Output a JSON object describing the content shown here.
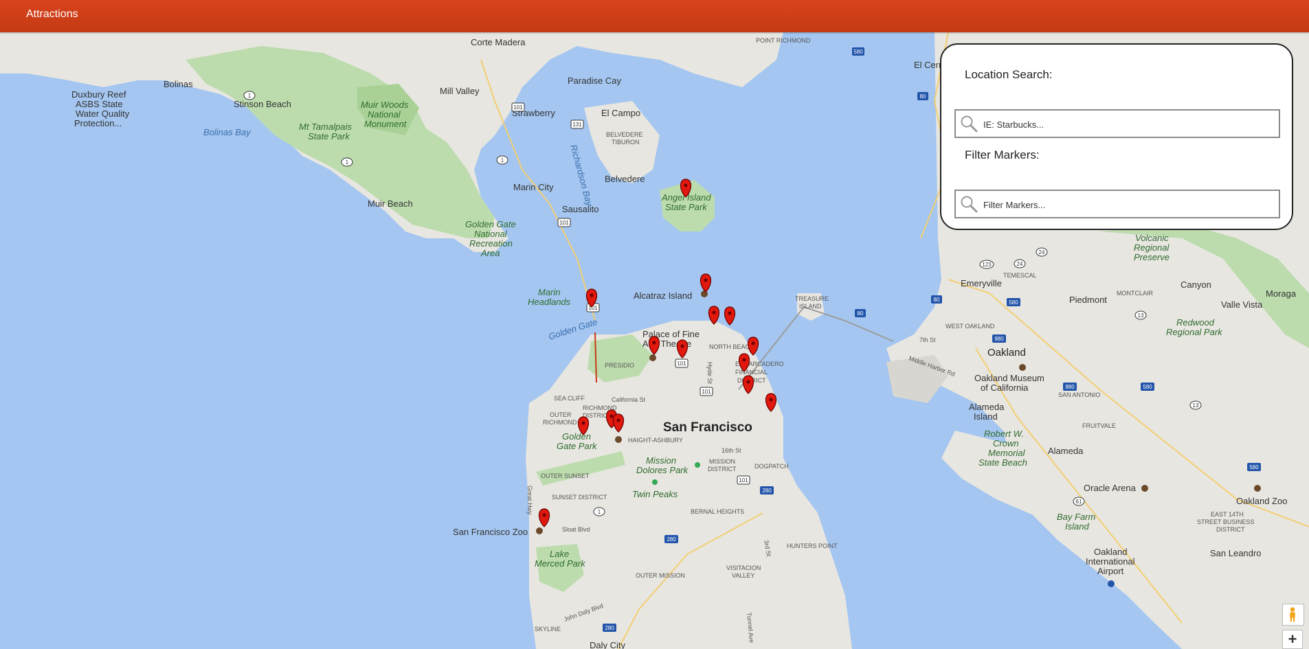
{
  "header": {
    "title": "Attractions"
  },
  "panel": {
    "location_label": "Location Search:",
    "location_placeholder": "IE: Starbucks...",
    "filter_label": "Filter Markers:",
    "filter_placeholder": "Filter Markers..."
  },
  "controls": {
    "zoom_in": "+"
  },
  "colors": {
    "header": "#d0401a",
    "water": "#a4c6f0",
    "land": "#e8e6e1",
    "park": "#bddcae",
    "marker": "#e0180d"
  },
  "labels": {
    "corte_madera": "Corte Madera",
    "point_richmond": "POINT RICHMOND",
    "el_cerrito": "El Cerri",
    "bolinas": "Bolinas",
    "duxbury": "Duxbury Reef",
    "asbs": "ASBS State",
    "water_quality": "Water Quality",
    "protection": "Protection...",
    "stinson": "Stinson Beach",
    "bolinas_bay": "Bolinas Bay",
    "mill_valley": "Mill Valley",
    "paradise_cay": "Paradise Cay",
    "muir_woods_1": "Muir Woods",
    "muir_woods_2": "National",
    "muir_woods_3": "Monument",
    "mt_tam_1": "Mt Tamalpais",
    "mt_tam_2": "State Park",
    "strawberry": "Strawberry",
    "el_campo": "El Campo",
    "belvedere_tiburon_1": "BELVEDERE",
    "belvedere_tiburon_2": "TIBURON",
    "belvedere": "Belvedere",
    "richardson_bay": "Richardson Bay",
    "marin_city": "Marin City",
    "muir_beach": "Muir Beach",
    "sausalito": "Sausalito",
    "angel_1": "Angel Island",
    "angel_2": "State Park",
    "ggnra_1": "Golden Gate",
    "ggnra_2": "National",
    "ggnra_3": "Recreation",
    "ggnra_4": "Area",
    "marin_headlands_1": "Marin",
    "marin_headlands_2": "Headlands",
    "alcatraz": "Alcatraz Island",
    "golden_gate": "Golden Gate",
    "palace_1": "Palace of Fine",
    "palace_2": "Arts Theatre",
    "presidio": "PRESIDIO",
    "north_beach": "NORTH BEACH",
    "embarcadero": "EMBARCADERO",
    "financial_1": "FINANCIAL",
    "financial_2": "DISTRICT",
    "treasure_1": "TREASURE",
    "treasure_2": "ISLAND",
    "sea_cliff": "SEA CLIFF",
    "california_st": "California St",
    "outer_richmond_1": "OUTER",
    "outer_richmond_2": "RICHMOND",
    "richmond_1": "RICHMOND",
    "richmond_2": "DISTRICT",
    "haight": "HAIGHT-ASHBURY",
    "san_francisco": "San Francisco",
    "ggpark_1": "Golden",
    "ggpark_2": "Gate Park",
    "outer_sunset": "OUTER SUNSET",
    "mission_dolores_1": "Mission",
    "mission_dolores_2": "Dolores Park",
    "mission_district_1": "MISSION",
    "mission_district_2": "DISTRICT",
    "dogpatch": "DOGPATCH",
    "sixteenth": "16th St",
    "twin_peaks": "Twin Peaks",
    "sunset_district": "SUNSET DISTRICT",
    "bernal": "BERNAL HEIGHTS",
    "sf_zoo": "San Francisco Zoo",
    "sloat": "Sloat Blvd",
    "great_hwy": "Great Hwy",
    "lake_merced_1": "Lake",
    "lake_merced_2": "Merced Park",
    "hunters_point": "HUNTERS POINT",
    "outer_mission": "OUTER MISSION",
    "visitacion_1": "VISITACION",
    "visitacion_2": "VALLEY",
    "john_daly": "John Daly Blvd",
    "daly_city": "Daly City",
    "skyline": "SKYLINE",
    "emeryville": "Emeryville",
    "temescal": "TEMESCAL",
    "piedmont": "Piedmont",
    "montclair": "MONTCLAIR",
    "canyon": "Canyon",
    "moraga": "Moraga",
    "volcanic_1": "Volcanic",
    "volcanic_2": "Regional",
    "volcanic_3": "Preserve",
    "west_oakland": "WEST OAKLAND",
    "oakland": "Oakland",
    "museum_1": "Oakland Museum",
    "museum_2": "of California",
    "seventh": "7th St",
    "middle_harbor": "Middle Harbor Rd",
    "valle_vista": "Valle Vista",
    "redwood_1": "Redwood",
    "redwood_2": "Regional Park",
    "alameda_island_1": "Alameda",
    "alameda_island_2": "Island",
    "san_antonio": "SAN ANTONIO",
    "fruitvale": "FRUITVALE",
    "crown_1": "Robert W.",
    "crown_2": "Crown",
    "crown_3": "Memorial",
    "crown_4": "State Beach",
    "alameda": "Alameda",
    "oracle_arena": "Oracle Arena",
    "oakland_zoo": "Oakland Zoo",
    "east_14th_1": "EAST 14TH",
    "east_14th_2": "STREET BUSINESS",
    "east_14th_3": "DISTRICT",
    "bay_farm_1": "Bay Farm",
    "bay_farm_2": "Island",
    "airport_1": "Oakland",
    "airport_2": "International",
    "airport_3": "Airport",
    "san_leandro": "San Leandro",
    "hyde_st": "Hyde St",
    "third_st": "3rd St",
    "tunnel_ave": "Tunnel Ave"
  },
  "shields": {
    "i580_a": "580",
    "us101_a": "101",
    "us131": "131",
    "sr1_a": "1",
    "sr1_b": "1",
    "sr1_c": "1",
    "us101_b": "101",
    "us101_c": "101",
    "us101_d": "101",
    "us101_e": "101",
    "us101_f": "101",
    "i80_a": "80",
    "i80_b": "80",
    "i80_c": "80",
    "i980": "980",
    "i580_b": "580",
    "sr24_a": "24",
    "sr24_b": "24",
    "sr123": "123",
    "sr13_a": "13",
    "sr13_b": "13",
    "i880": "880",
    "i580_c": "580",
    "i280_a": "280",
    "i280_b": "280",
    "i280_c": "280",
    "sr61": "61",
    "i580_d": "580",
    "sr1_d": "1"
  }
}
